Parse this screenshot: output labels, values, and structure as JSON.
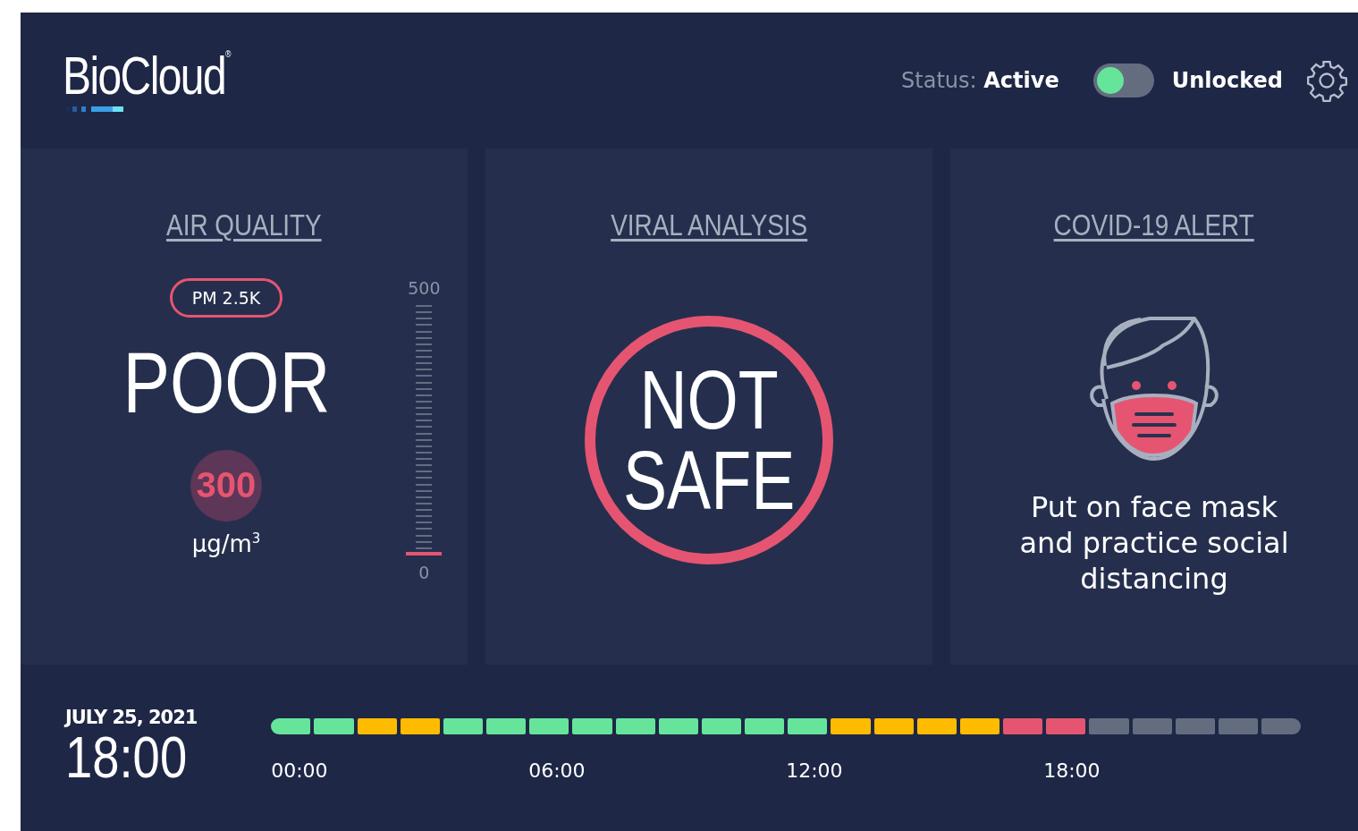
{
  "header": {
    "logo": "BioCloud",
    "logo_mark": "®",
    "status_label": "Status:",
    "status_value": "Active",
    "lock_toggle": {
      "locked": false,
      "label": "Unlocked"
    }
  },
  "panels": [
    {
      "kind": "air",
      "title": "AIR QUALITY",
      "pill": "PM 2.5K",
      "rating": "POOR",
      "value": "300",
      "unit": "μg/m",
      "unit_power": "3",
      "gauge": {
        "max": "500",
        "min": "0",
        "level": 0
      }
    },
    {
      "kind": "viral",
      "title": "VIRAL ANALYSIS",
      "lines": [
        "NOT",
        "SAFE"
      ]
    },
    {
      "kind": "alert",
      "title": "COVID-19 ALERT",
      "message": "Put on face mask and practice social distancing"
    }
  ],
  "footer": {
    "date": "JULY 25, 2021",
    "time": "18:00",
    "segments": [
      {
        "color": "#66e59a"
      },
      {
        "color": "#66e59a"
      },
      {
        "color": "#ffbb00"
      },
      {
        "color": "#ffbb00"
      },
      {
        "color": "#66e59a"
      },
      {
        "color": "#66e59a"
      },
      {
        "color": "#66e59a"
      },
      {
        "color": "#66e59a"
      },
      {
        "color": "#66e59a"
      },
      {
        "color": "#66e59a"
      },
      {
        "color": "#66e59a"
      },
      {
        "color": "#66e59a"
      },
      {
        "color": "#66e59a"
      },
      {
        "color": "#ffbb00"
      },
      {
        "color": "#ffbb00"
      },
      {
        "color": "#ffbb00"
      },
      {
        "color": "#ffbb00"
      },
      {
        "color": "#e55571"
      },
      {
        "color": "#e55571"
      },
      {
        "color": "#646d80"
      },
      {
        "color": "#646d80"
      },
      {
        "color": "#646d80"
      },
      {
        "color": "#646d80"
      },
      {
        "color": "#646d80"
      }
    ],
    "ticks": [
      "00:00",
      "06:00",
      "12:00",
      "18:00"
    ]
  }
}
